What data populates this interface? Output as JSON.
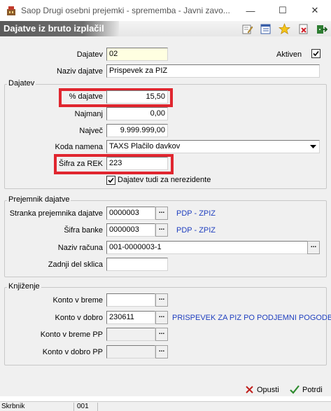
{
  "window": {
    "title": "Saop   Drugi osebni prejemki  - sprememba - Javni zavo...",
    "minimize_glyph": "—",
    "maximize_glyph": "☐",
    "close_glyph": "✕"
  },
  "toolbar": {
    "title": "Dajatve iz bruto izplačil",
    "icons": [
      "edit-icon",
      "list-icon",
      "favorite-star-icon",
      "delete-icon",
      "exit-icon"
    ]
  },
  "form": {
    "dajatev_label": "Dajatev",
    "dajatev_value": "02",
    "aktiven_label": "Aktiven",
    "aktiven_checked": true,
    "naziv_label": "Naziv dajatve",
    "naziv_value": "Prispevek za PIZ"
  },
  "group_dajatev": {
    "title": "Dajatev",
    "procent_label": "% dajatve",
    "procent_value": "15,50",
    "najmanj_label": "Najmanj",
    "najmanj_value": "0,00",
    "najvec_label": "Največ",
    "najvec_value": "9.999.999,00",
    "koda_label": "Koda namena",
    "koda_value": "TAXS Plačilo davkov",
    "sifra_rek_label": "Šifra za REK",
    "sifra_rek_value": "223",
    "nerezidente_label": "Dajatev tudi za nerezidente",
    "nerezidente_checked": true
  },
  "group_prejemnik": {
    "title": "Prejemnik dajatve",
    "stranka_label": "Stranka prejemnika dajatve",
    "stranka_value": "0000003",
    "stranka_name": "PDP - ZPIZ",
    "banka_label": "Šifra banke",
    "banka_value": "0000003",
    "banka_name": "PDP - ZPIZ",
    "racun_label": "Naziv računa",
    "racun_value": "001-0000003-1",
    "sklic_label": "Zadnji del sklica",
    "sklic_value": "",
    "dots": "..."
  },
  "group_knjizenje": {
    "title": "Knjiženje",
    "breme_label": "Konto v breme",
    "breme_value": "",
    "dobro_label": "Konto v dobro",
    "dobro_value": "230611",
    "dobro_name": "PRISPEVEK ZA PIZ PO PODJEMNI POGODBI",
    "breme_pp_label": "Konto v breme PP",
    "breme_pp_value": "",
    "dobro_pp_label": "Konto v dobro PP",
    "dobro_pp_value": ""
  },
  "footer": {
    "opusti_label": "Opusti",
    "potrdi_label": "Potrdi"
  },
  "statusbar": {
    "cell1": "Skrbnik",
    "cell2": "001"
  },
  "colors": {
    "highlight": "#e0262f",
    "link": "#1f3fbf",
    "yellow_field": "#ffffe1"
  }
}
